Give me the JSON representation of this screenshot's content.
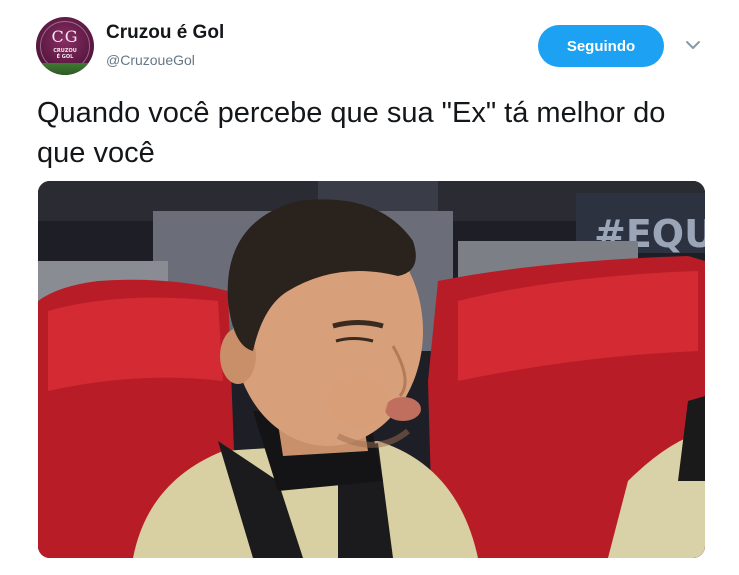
{
  "tweet": {
    "author": {
      "display_name": "Cruzou é Gol",
      "handle": "@CruzoueGol",
      "avatar_logo": "CG",
      "avatar_text_line1": "CRUZOU",
      "avatar_text_line2": "É GOL"
    },
    "follow_button_label": "Seguindo",
    "text": "Quando você percebe que sua \"Ex\" tá melhor do que você",
    "media": {
      "background_sign_text": "#EQUI"
    }
  },
  "colors": {
    "accent": "#1da1f2",
    "text_primary": "#14171a",
    "text_secondary": "#657786",
    "seat_red": "#c8202b"
  },
  "icons": {
    "caret": "chevron-down-icon"
  }
}
